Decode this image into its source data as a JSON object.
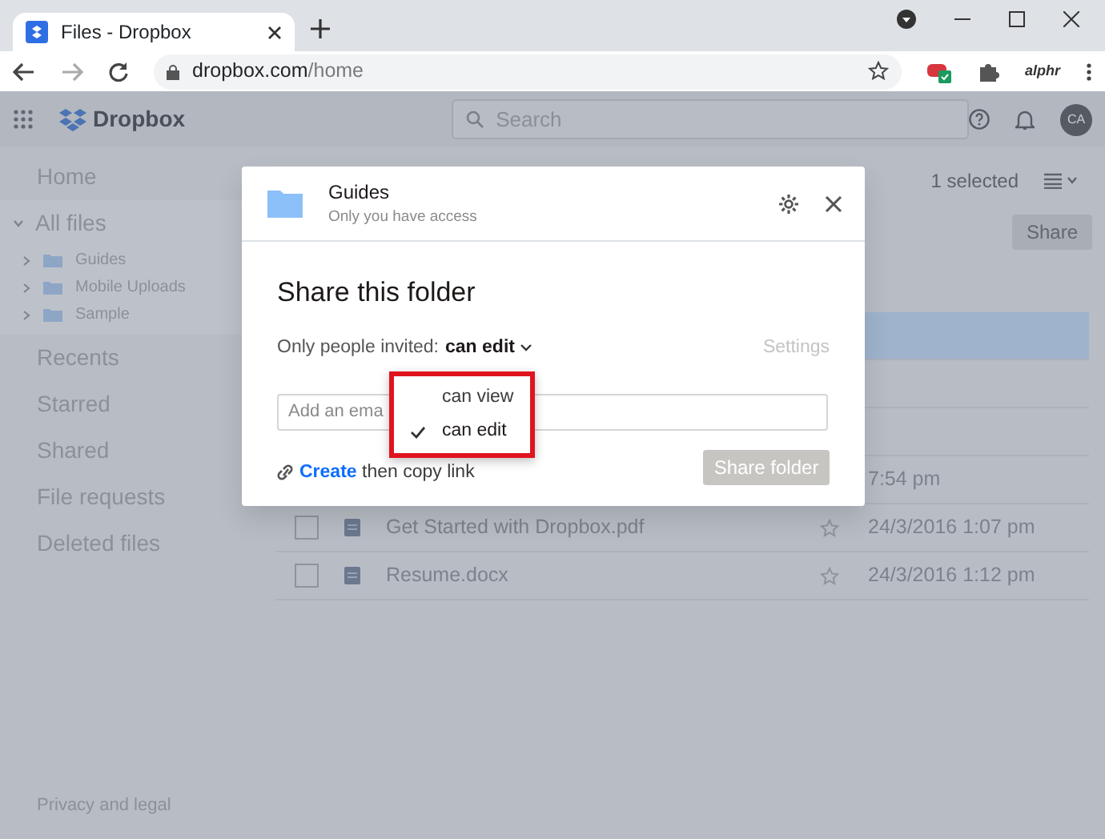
{
  "browser": {
    "tab": {
      "title": "Files - Dropbox"
    },
    "address": {
      "host": "dropbox.com",
      "path": "/home"
    },
    "extension_label": "alphr"
  },
  "app_header": {
    "logo": "Dropbox",
    "search": {
      "placeholder": "Search"
    },
    "avatar": "CA"
  },
  "sidebar": {
    "items": [
      {
        "label": "Home",
        "kind": "link"
      },
      {
        "label": "All files",
        "kind": "tree",
        "expanded": true,
        "children": [
          {
            "label": "Guides"
          },
          {
            "label": "Mobile Uploads"
          },
          {
            "label": "Sample"
          }
        ]
      },
      {
        "label": "Recents",
        "kind": "link"
      },
      {
        "label": "Starred",
        "kind": "link"
      },
      {
        "label": "Shared",
        "kind": "link"
      },
      {
        "label": "File requests",
        "kind": "link"
      },
      {
        "label": "Deleted files",
        "kind": "link"
      }
    ],
    "footer": "Privacy and legal"
  },
  "toolbar": {
    "selection": "1 selected",
    "share_button": "Share"
  },
  "files": [
    {
      "selected": true
    },
    {
      "selected": false
    },
    {
      "selected": false
    },
    {
      "selected": false,
      "modified": "7:54 pm"
    },
    {
      "selected": false,
      "name": "Get Started with Dropbox.pdf",
      "modified": "24/3/2016 1:07 pm"
    },
    {
      "selected": false,
      "name": "Resume.docx",
      "modified": "24/3/2016 1:12 pm"
    }
  ],
  "dialog": {
    "folder": {
      "name": "Guides",
      "access": "Only you have access"
    },
    "title": "Share this folder",
    "permission": {
      "prefix": "Only people invited:",
      "value": "can edit"
    },
    "settings_link": "Settings",
    "email": {
      "placeholder": "Add an ema"
    },
    "link": {
      "action": "Create",
      "rest": "then copy link"
    },
    "submit": {
      "label": "Share folder",
      "disabled": true
    },
    "menu": {
      "items": [
        {
          "label": "can view",
          "selected": false
        },
        {
          "label": "can edit",
          "selected": true
        }
      ]
    }
  }
}
